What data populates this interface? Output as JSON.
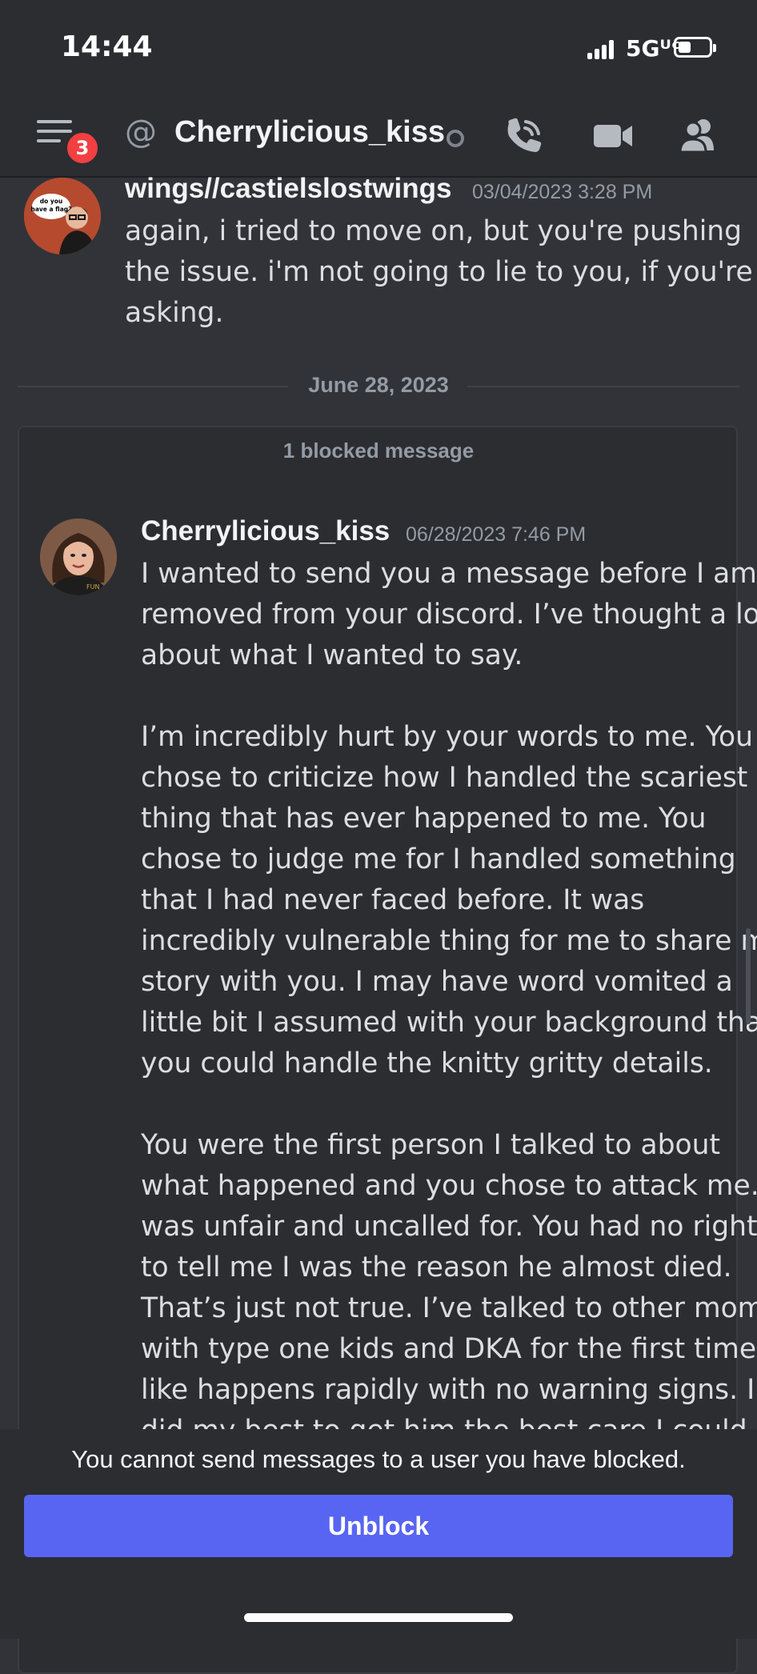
{
  "status_bar": {
    "time": "14:44",
    "network": "5Gᵁᶜ"
  },
  "header": {
    "badge_count": "3",
    "at_symbol": "@",
    "channel_name": "Cherrylicious_kiss"
  },
  "messages": [
    {
      "author": "wings//castielslostwings",
      "timestamp": "03/04/2023 3:28 PM",
      "avatar_text": "do you have a flag?",
      "lines": [
        "again, i tried to move on, but you're pushing",
        "the issue. i'm not going to lie to you, if you're",
        "asking."
      ]
    }
  ],
  "date_divider": "June 28, 2023",
  "blocked": {
    "label": "1 blocked message",
    "message": {
      "author": "Cherrylicious_kiss",
      "timestamp": "06/28/2023 7:46 PM",
      "lines": [
        "I wanted to send you a message before I am",
        "removed from your discord. I’ve thought a lot",
        "about what I wanted to say.",
        "",
        "I’m incredibly hurt by your words to me. You",
        "chose to criticize how I handled the scariest",
        "thing that has ever happened to me. You",
        "chose to judge me for I handled something",
        "that I had never faced before. It was",
        "incredibly vulnerable thing for me to share my",
        "story with you. I may have word vomited a",
        "little bit I assumed with your background that",
        "you could handle the knitty gritty details.",
        "",
        "You were the first person I talked to about",
        "what happened and you chose to attack me. It",
        "was unfair and uncalled for. You had no right",
        "to tell me I was the reason he almost died.",
        "That’s just not true. I’ve talked to other moms",
        "with type one kids and DKA for the first time",
        "like happens rapidly with no warning signs. I",
        "did my best to get him the best care I could"
      ]
    }
  },
  "footer": {
    "notice": "You cannot send messages to a user you have blocked.",
    "unblock_label": "Unblock"
  },
  "colors": {
    "accent": "#5865f2",
    "badge": "#f23f42",
    "background": "#313338"
  }
}
